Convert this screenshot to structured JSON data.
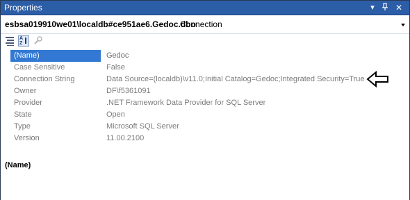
{
  "window": {
    "title": "Properties"
  },
  "selector": {
    "object_name": "esbsa019910we01\\localdb#ce951ae6.Gedoc.dbo",
    "object_type": "Connection"
  },
  "toolbar": {
    "buttons": [
      "categorized-icon",
      "alphabetical-icon",
      "property-pages-icon"
    ]
  },
  "properties": [
    {
      "label": "(Name)",
      "value": "Gedoc"
    },
    {
      "label": "Case Sensitive",
      "value": "False"
    },
    {
      "label": "Connection String",
      "value": "Data Source=(localdb)\\v11.0;Initial Catalog=Gedoc;Integrated Security=True"
    },
    {
      "label": "Owner",
      "value": "DF\\f5361091"
    },
    {
      "label": "Provider",
      "value": ".NET Framework Data Provider for SQL Server"
    },
    {
      "label": "State",
      "value": "Open"
    },
    {
      "label": "Type",
      "value": "Microsoft SQL Server"
    },
    {
      "label": "Version",
      "value": "11.00.2100"
    }
  ],
  "description": {
    "title": "(Name)"
  },
  "colors": {
    "titlebar": "#2c5da7",
    "selection": "#3379d3"
  }
}
